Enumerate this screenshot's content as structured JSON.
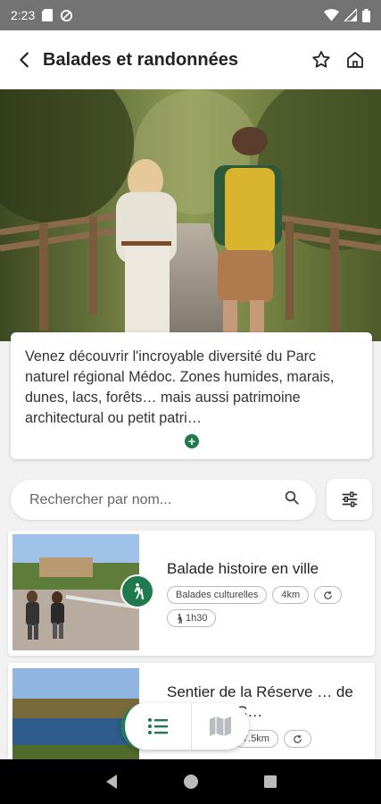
{
  "status": {
    "time": "2:23"
  },
  "header": {
    "title": "Balades et randonnées"
  },
  "description": {
    "text": "Venez découvrir l'incroyable diversité du Parc naturel régional Médoc. Zones humides, marais, dunes, lacs, forêts… mais aussi patrimoine architectural ou petit patri…"
  },
  "search": {
    "placeholder": "Rechercher par nom..."
  },
  "treks": [
    {
      "title": "Balade histoire en ville",
      "chips": [
        "Balades culturelles",
        "4km",
        "1h30"
      ]
    },
    {
      "title": "Sentier de la Réserve … de l'étang de C…",
      "chips": [
        "7.5km"
      ]
    }
  ],
  "colors": {
    "accent": "#1f7a4d",
    "status_bar": "#737373"
  },
  "icons": {
    "back": "arrow-left-icon",
    "favorite": "star-outline-icon",
    "home": "home-icon",
    "search": "search-icon",
    "filter": "sliders-icon",
    "practice": "hiker-icon",
    "list": "list-icon",
    "map": "map-icon"
  }
}
